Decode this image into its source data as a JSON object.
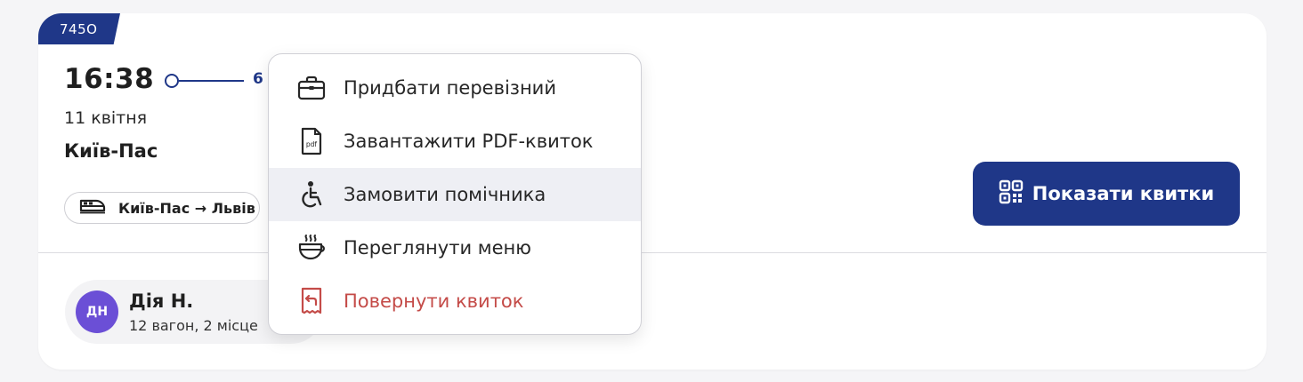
{
  "trip": {
    "train_number": "745О",
    "departure_time": "16:38",
    "duration_partial": "6",
    "date": "11 квітня",
    "station": "Київ-Пас",
    "route_chip": "Київ-Пас → Львів"
  },
  "passenger": {
    "initials": "ДН",
    "name": "Дія Н.",
    "seat": "12 вагон, 2 місце"
  },
  "actions": {
    "show_tickets": "Показати квитки"
  },
  "menu": {
    "items": [
      {
        "label": "Придбати перевізний",
        "icon": "briefcase-icon"
      },
      {
        "label": "Завантажити PDF-квиток",
        "icon": "pdf-file-icon"
      },
      {
        "label": "Замовити помічника",
        "icon": "wheelchair-icon",
        "highlighted": true
      },
      {
        "label": "Переглянути меню",
        "icon": "coffee-cup-icon"
      },
      {
        "label": "Повернути квиток",
        "icon": "return-ticket-icon",
        "danger": true
      }
    ]
  },
  "colors": {
    "brand": "#1f3788",
    "danger": "#c44b48",
    "avatar": "#6b4fd6",
    "highlight": "#eeeff4"
  }
}
